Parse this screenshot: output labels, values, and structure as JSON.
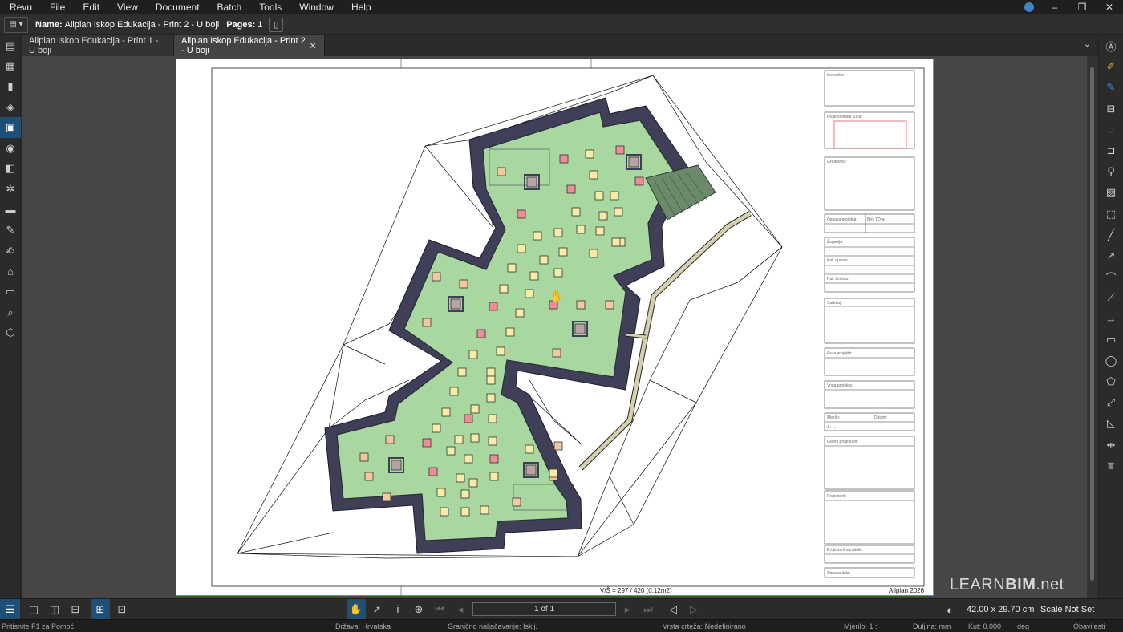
{
  "menubar": {
    "items": [
      "Revu",
      "File",
      "Edit",
      "View",
      "Document",
      "Batch",
      "Tools",
      "Window",
      "Help"
    ]
  },
  "window": {
    "minimize": "–",
    "restore": "❐",
    "close": "✕"
  },
  "document_bar": {
    "name_label": "Name:",
    "name_value": "Allplan Iskop Edukacija - Print 2 - U boji",
    "pages_label": "Pages:",
    "pages_value": "1"
  },
  "tabs": [
    {
      "label": "Allplan Iskop Edukacija - Print 1 - U boji",
      "active": false
    },
    {
      "label": "Allplan Iskop Edukacija - Print 2 - U boji",
      "active": true,
      "close": "✕"
    }
  ],
  "drawing": {
    "scale_note": "V/Š = 297 / 420 (0.12m2)",
    "footer_brand": "Allplan 2026",
    "title_block": {
      "investor": "Investitor:",
      "design_firm": "Projektantska kuća:",
      "building": "Građevina:",
      "project_mark": "Oznaka projekta:",
      "td_number": "Broj TD-a:",
      "county": "Županija:",
      "cadastral_municipality": "Kat. općina:",
      "cadastral_parcel": "Kat. čestica:",
      "content": "Sadržaj:",
      "project_phase": "Faza projekta:",
      "project_type": "Vrsta projekta:",
      "scale_label": "Mjerilo:",
      "scale_value": "1 : ...",
      "date_label": "Datum:",
      "chief_designer": "Glavni projektant:",
      "designer": "Projektant:",
      "designer_associate": "Projektant suradnik:",
      "sheet_mark": "Oznaka lista:"
    }
  },
  "bottom_bar": {
    "page_indicator": "1 of 1",
    "page_dimensions": "42.00 x 29.70 cm",
    "scale_status": "Scale Not Set"
  },
  "watermark": {
    "part1": "LEARN",
    "part2": "BIM",
    "part3": ".net"
  },
  "status_bar": {
    "help": "Pritisnite F1 za Pomoć.",
    "country": "Država:  Hrvatska",
    "bounds": "Granično naljačavanje:  Isklj.",
    "line_type": "Vrsta crteža:  Nedefinirano",
    "scale": "Mjerilo:  1 :",
    "length": "Duljina:  mm",
    "angle": "Kut:  0.000",
    "unit": "deg",
    "notify": "Obavijesti"
  },
  "colors": {
    "accent": "#1d4f77",
    "green_fill": "#a8d8a0",
    "wall": "#3f3f58",
    "pile_yellow": "#f6eca8",
    "pile_orange": "#f3c7a0",
    "pile_red": "#ee8c98",
    "pile_gray": "#b8a2a6",
    "ramp": "#d5d1ad"
  }
}
